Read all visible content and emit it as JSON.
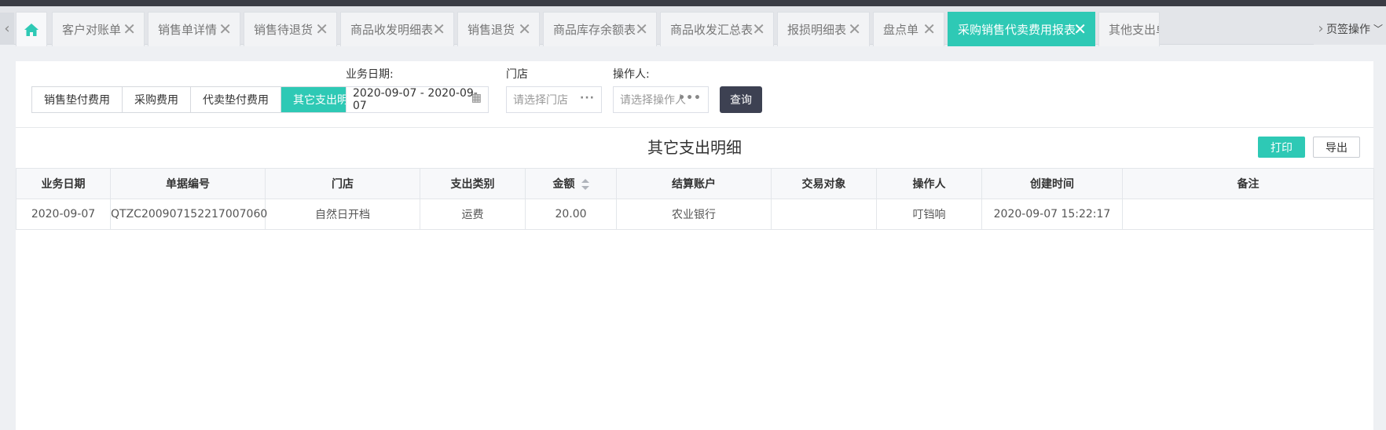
{
  "tabs": {
    "items": [
      {
        "label": "客户对账单"
      },
      {
        "label": "销售单详情"
      },
      {
        "label": "销售待退货"
      },
      {
        "label": "商品收发明细表"
      },
      {
        "label": "销售退货"
      },
      {
        "label": "商品库存余额表"
      },
      {
        "label": "商品收发汇总表"
      },
      {
        "label": "报损明细表"
      },
      {
        "label": "盘点单"
      },
      {
        "label": "采购销售代卖费用报表"
      },
      {
        "label": "其他支出单"
      }
    ],
    "close_glyph": "✕",
    "page_ops_label": "页签操作",
    "active_color": "#2ec9b5"
  },
  "segments": [
    {
      "label": "销售垫付费用"
    },
    {
      "label": "采购费用"
    },
    {
      "label": "代卖垫付费用"
    },
    {
      "label": "其它支出明细"
    }
  ],
  "filters": {
    "date_label": "业务日期:",
    "date_value": "2020-09-07 - 2020-09-07",
    "store_label": "门店",
    "store_placeholder": "请选择门店",
    "operator_label": "操作人:",
    "operator_placeholder": "请选择操作人",
    "query_label": "查询"
  },
  "report": {
    "title": "其它支出明细",
    "print_label": "打印",
    "export_label": "导出"
  },
  "table": {
    "columns": [
      "业务日期",
      "单据编号",
      "门店",
      "支出类别",
      "金额",
      "结算账户",
      "交易对象",
      "操作人",
      "创建时间",
      "备注"
    ],
    "rows": [
      [
        "2020-09-07",
        "QTZC200907152217007060",
        "自然日开档",
        "运费",
        "20.00",
        "农业银行",
        "",
        "叮铛响",
        "2020-09-07 15:22:17",
        ""
      ]
    ]
  }
}
